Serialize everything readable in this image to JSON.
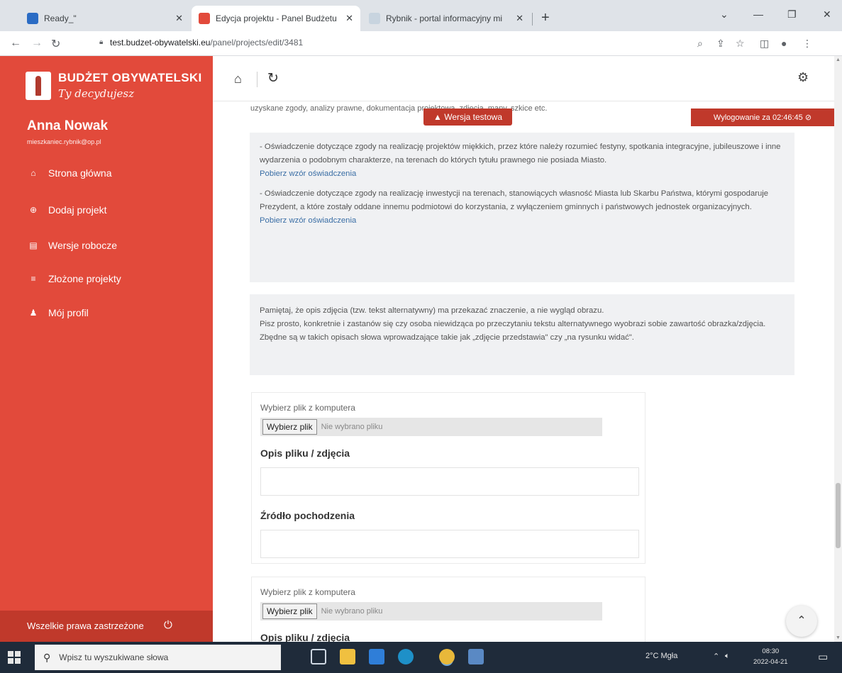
{
  "browser": {
    "tabs": [
      {
        "title": "Ready_\"",
        "active": false
      },
      {
        "title": "Edycja projektu - Panel Budżetu",
        "active": true
      },
      {
        "title": "Rybnik - portal informacyjny mi",
        "active": false
      }
    ],
    "url_domain": "test.budzet-obywatelski.eu",
    "url_path": "/panel/projects/edit/3481"
  },
  "sidebar": {
    "brand": "BUDŻET OBYWATELSKI",
    "slogan": "Ty decydujesz",
    "user_name": "Anna Nowak",
    "user_email": "mieszkaniec.rybnik@op.pl",
    "menu": [
      {
        "label": "Strona główna",
        "icon": "home-icon"
      },
      {
        "label": "Dodaj projekt",
        "icon": "plus-circle-icon"
      },
      {
        "label": "Wersje robocze",
        "icon": "file-icon"
      },
      {
        "label": "Złożone projekty",
        "icon": "list-icon"
      },
      {
        "label": "Mój profil",
        "icon": "user-icon"
      }
    ],
    "footer": "Wszelkie prawa zastrzeżone"
  },
  "header": {
    "test_badge": "▲ Wersja testowa",
    "logout_timer": "Wylogowanie za 02:46:45 ⊘"
  },
  "content": {
    "cut_text": "uzyskane zgody, analizy prawne, dokumentacja projektowa, zdjęcia, mapy, szkice etc.",
    "note1": {
      "p1": "- Oświadczenie dotyczące zgody na realizację projektów miękkich, przez które należy rozumieć festyny, spotkania integracyjne, jubileuszowe i inne wydarzenia o podobnym charakterze, na terenach do których tytułu prawnego nie posiada Miasto.",
      "link1": "Pobierz wzór oświadczenia",
      "p2": "- Oświadczenie dotyczące zgody na realizację inwestycji na terenach, stanowiących własność Miasta lub Skarbu Państwa, którymi gospodaruje Prezydent, a które zostały oddane innemu podmiotowi do korzystania, z wyłączeniem gminnych i państwowych jednostek organizacyjnych.",
      "link2": "Pobierz wzór oświadczenia"
    },
    "note2": {
      "l1": "Pamiętaj, że opis zdjęcia (tzw. tekst alternatywny) ma przekazać znaczenie, a nie wygląd obrazu.",
      "l2": "Pisz prosto, konkretnie i zastanów się czy osoba niewidząca po przeczytaniu tekstu alternatywnego wyobrazi sobie zawartość obrazka/zdjęcia.",
      "l3": "Zbędne są w takich opisach słowa wprowadzające takie jak „zdjęcie przedstawia\" czy „na rysunku widać\"."
    },
    "file_blocks": [
      {
        "choose_label": "Wybierz plik z komputera",
        "button": "Wybierz plik",
        "status": "Nie wybrano pliku",
        "desc_label": "Opis pliku / zdjęcia",
        "desc_value": "",
        "source_label": "Źródło pochodzenia",
        "source_value": ""
      },
      {
        "choose_label": "Wybierz plik z komputera",
        "button": "Wybierz plik",
        "status": "Nie wybrano pliku",
        "desc_label": "Opis pliku / zdjęcia"
      }
    ]
  },
  "taskbar": {
    "search_placeholder": "Wpisz tu wyszukiwane słowa",
    "weather": "2°C Mgła",
    "time": "08:30",
    "date": "2022-04-21"
  },
  "colors": {
    "sidebar": "#e24a3b",
    "badge": "#c0392b",
    "link": "#3a6ea5"
  }
}
